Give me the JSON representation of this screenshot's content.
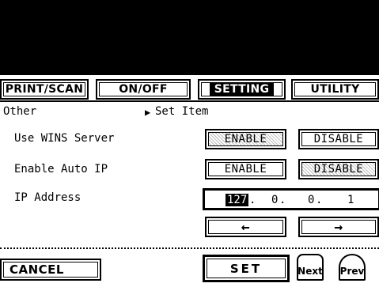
{
  "tabs": [
    {
      "label": "PRINT/SCAN",
      "active": false
    },
    {
      "label": "ON/OFF",
      "active": false
    },
    {
      "label": "SETTING",
      "active": true
    },
    {
      "label": "UTILITY",
      "active": false
    }
  ],
  "breadcrumb": {
    "parent": "Other",
    "marker": "▶",
    "current": "Set Item"
  },
  "rows": {
    "wins": {
      "label": "Use WINS Server",
      "enable": "ENABLE",
      "disable": "DISABLE",
      "selected": "ENABLE"
    },
    "auto_ip": {
      "label": "Enable Auto IP",
      "enable": "ENABLE",
      "disable": "DISABLE",
      "selected": "DISABLE"
    },
    "ip": {
      "label": "IP Address",
      "octets": [
        "127",
        "0",
        "0",
        "1"
      ],
      "active_octet": 0
    }
  },
  "arrows": {
    "left": "←",
    "right": "→"
  },
  "footer": {
    "cancel": "CANCEL",
    "set": "SET",
    "next": "Next",
    "prev": "Prev"
  }
}
